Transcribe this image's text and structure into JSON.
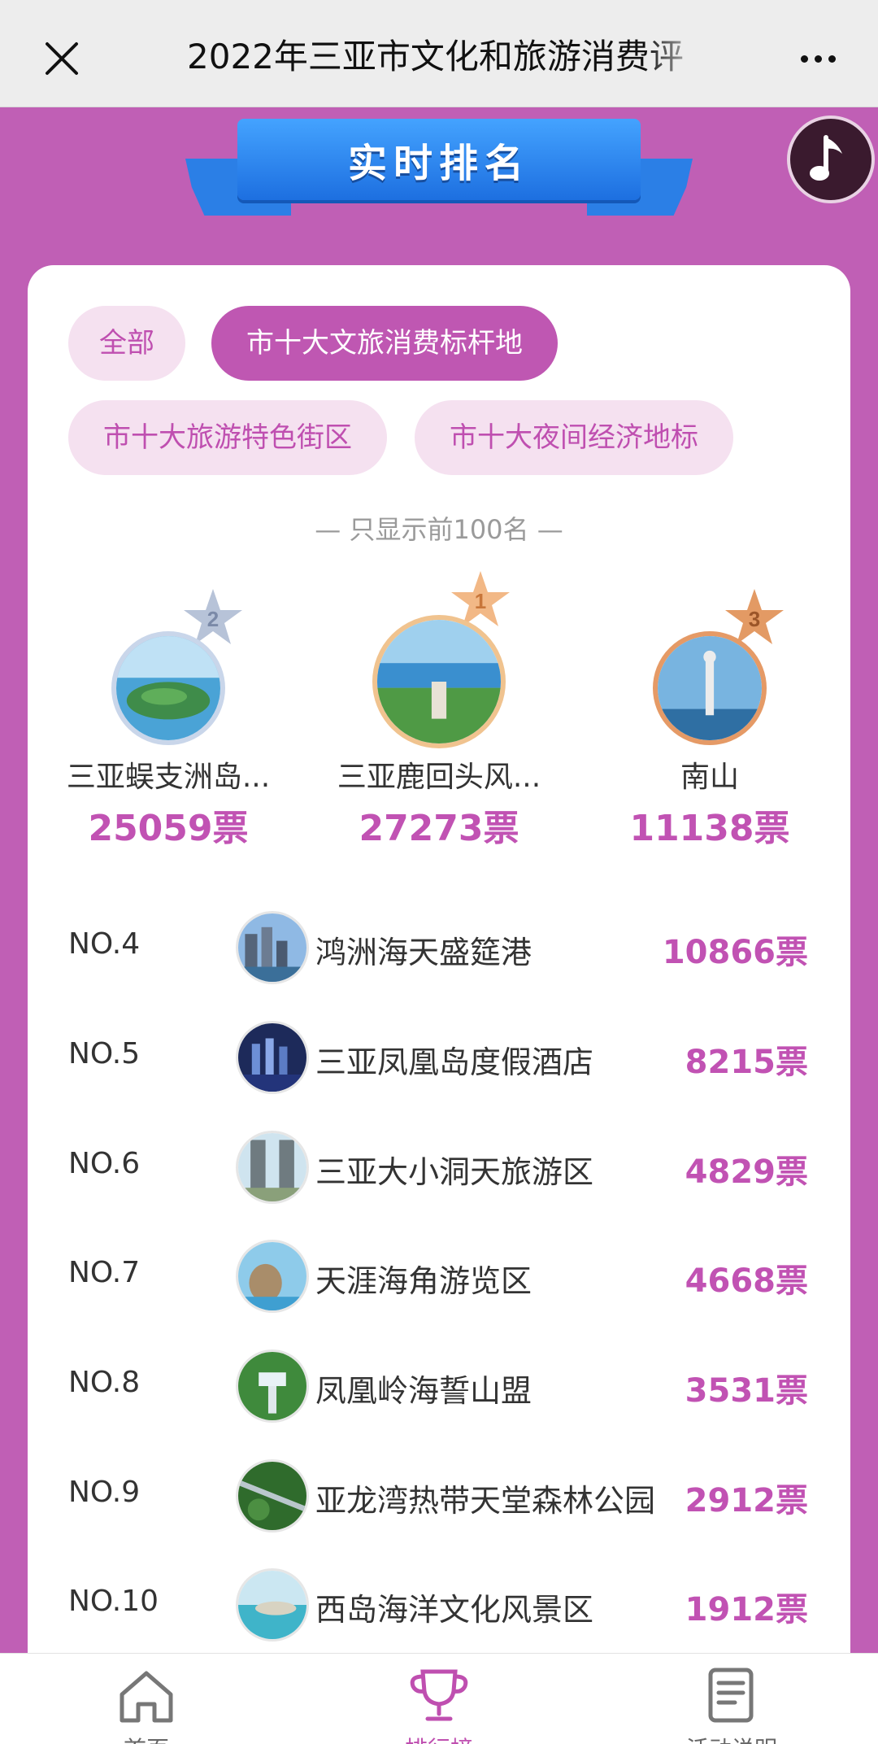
{
  "topbar": {
    "title": "2022年三亚市文化和旅游消费评",
    "close_icon": "close-icon",
    "more_icon": "more-icon"
  },
  "banner": {
    "label": "实时排名"
  },
  "music": {
    "icon": "music-note-icon"
  },
  "filters": [
    {
      "label": "全部",
      "active": false
    },
    {
      "label": "市十大文旅消费标杆地",
      "active": true
    },
    {
      "label": "市十大旅游特色街区",
      "active": false
    },
    {
      "label": "市十大夜间经济地标",
      "active": false
    }
  ],
  "notice": "— 只显示前100名 —",
  "podium": [
    {
      "rank": "2",
      "name": "三亚蜈支洲岛...",
      "votes": "25059票"
    },
    {
      "rank": "1",
      "name": "三亚鹿回头风...",
      "votes": "27273票"
    },
    {
      "rank": "3",
      "name": "南山",
      "votes": "11138票"
    }
  ],
  "list": [
    {
      "rank": "NO.4",
      "name": "鸿洲海天盛筵港",
      "votes": "10866票"
    },
    {
      "rank": "NO.5",
      "name": "三亚凤凰岛度假酒店",
      "votes": "8215票"
    },
    {
      "rank": "NO.6",
      "name": "三亚大小洞天旅游区",
      "votes": "4829票"
    },
    {
      "rank": "NO.7",
      "name": "天涯海角游览区",
      "votes": "4668票"
    },
    {
      "rank": "NO.8",
      "name": "凤凰岭海誓山盟",
      "votes": "3531票"
    },
    {
      "rank": "NO.9",
      "name": "亚龙湾热带天堂森林公园",
      "votes": "2912票"
    },
    {
      "rank": "NO.10",
      "name": "西岛海洋文化风景区",
      "votes": "1912票"
    }
  ],
  "nav": [
    {
      "label": "首页",
      "icon": "home-icon",
      "active": false
    },
    {
      "label": "排行榜",
      "icon": "trophy-icon",
      "active": true
    },
    {
      "label": "活动说明",
      "icon": "document-icon",
      "active": false
    }
  ],
  "colors": {
    "brand": "#c05fb5",
    "accent": "#c152b3",
    "ribbon": "#2b7fe6"
  }
}
